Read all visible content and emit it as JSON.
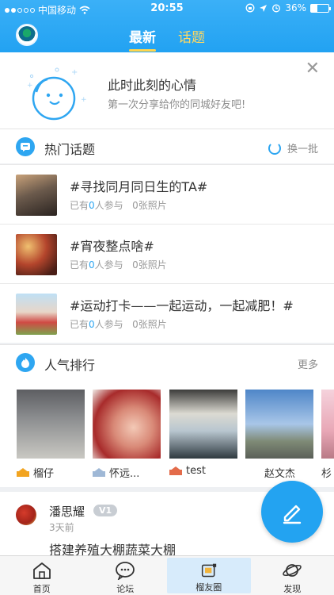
{
  "status_bar": {
    "carrier": "中国移动",
    "time": "20:55",
    "battery": "36%",
    "battery_level": 0.36
  },
  "header": {
    "tabs": [
      {
        "label": "最新",
        "active": true
      },
      {
        "label": "话题",
        "active": false
      }
    ]
  },
  "mood_card": {
    "title": "此时此刻的心情",
    "subtitle": "第一次分享给你的同城好友吧!"
  },
  "hot_topics": {
    "title": "热门话题",
    "action": "换一批",
    "items": [
      {
        "title": "#寻找同月同日生的TA#",
        "joined_prefix": "已有",
        "joined_count": "0",
        "joined_suffix": "人参与",
        "photos": "0张照片"
      },
      {
        "title": "#宵夜整点啥#",
        "joined_prefix": "已有",
        "joined_count": "0",
        "joined_suffix": "人参与",
        "photos": "0张照片"
      },
      {
        "title": "#运动打卡——一起运动，一起减肥！#",
        "joined_prefix": "已有",
        "joined_count": "0",
        "joined_suffix": "人参与",
        "photos": "0张照片"
      }
    ]
  },
  "popularity": {
    "title": "人气排行",
    "more": "更多",
    "items": [
      {
        "name": "榴仔",
        "crown": "gold"
      },
      {
        "name": "怀远...",
        "crown": "silver"
      },
      {
        "name": "test",
        "crown": "bronze"
      },
      {
        "name": "赵文杰",
        "crown": "none"
      },
      {
        "name": "杉",
        "crown": "none"
      }
    ]
  },
  "post": {
    "author": "潘思耀",
    "badge": "V1",
    "time": "3天前",
    "title": "搭建养殖大棚蔬菜大棚"
  },
  "tabbar": [
    {
      "label": "首页"
    },
    {
      "label": "论坛"
    },
    {
      "label": "榴友圈"
    },
    {
      "label": "发现"
    }
  ],
  "colors": {
    "accent": "#23a3f1",
    "tab_underline": "#ffd54d",
    "count": "#2ea6f1"
  }
}
